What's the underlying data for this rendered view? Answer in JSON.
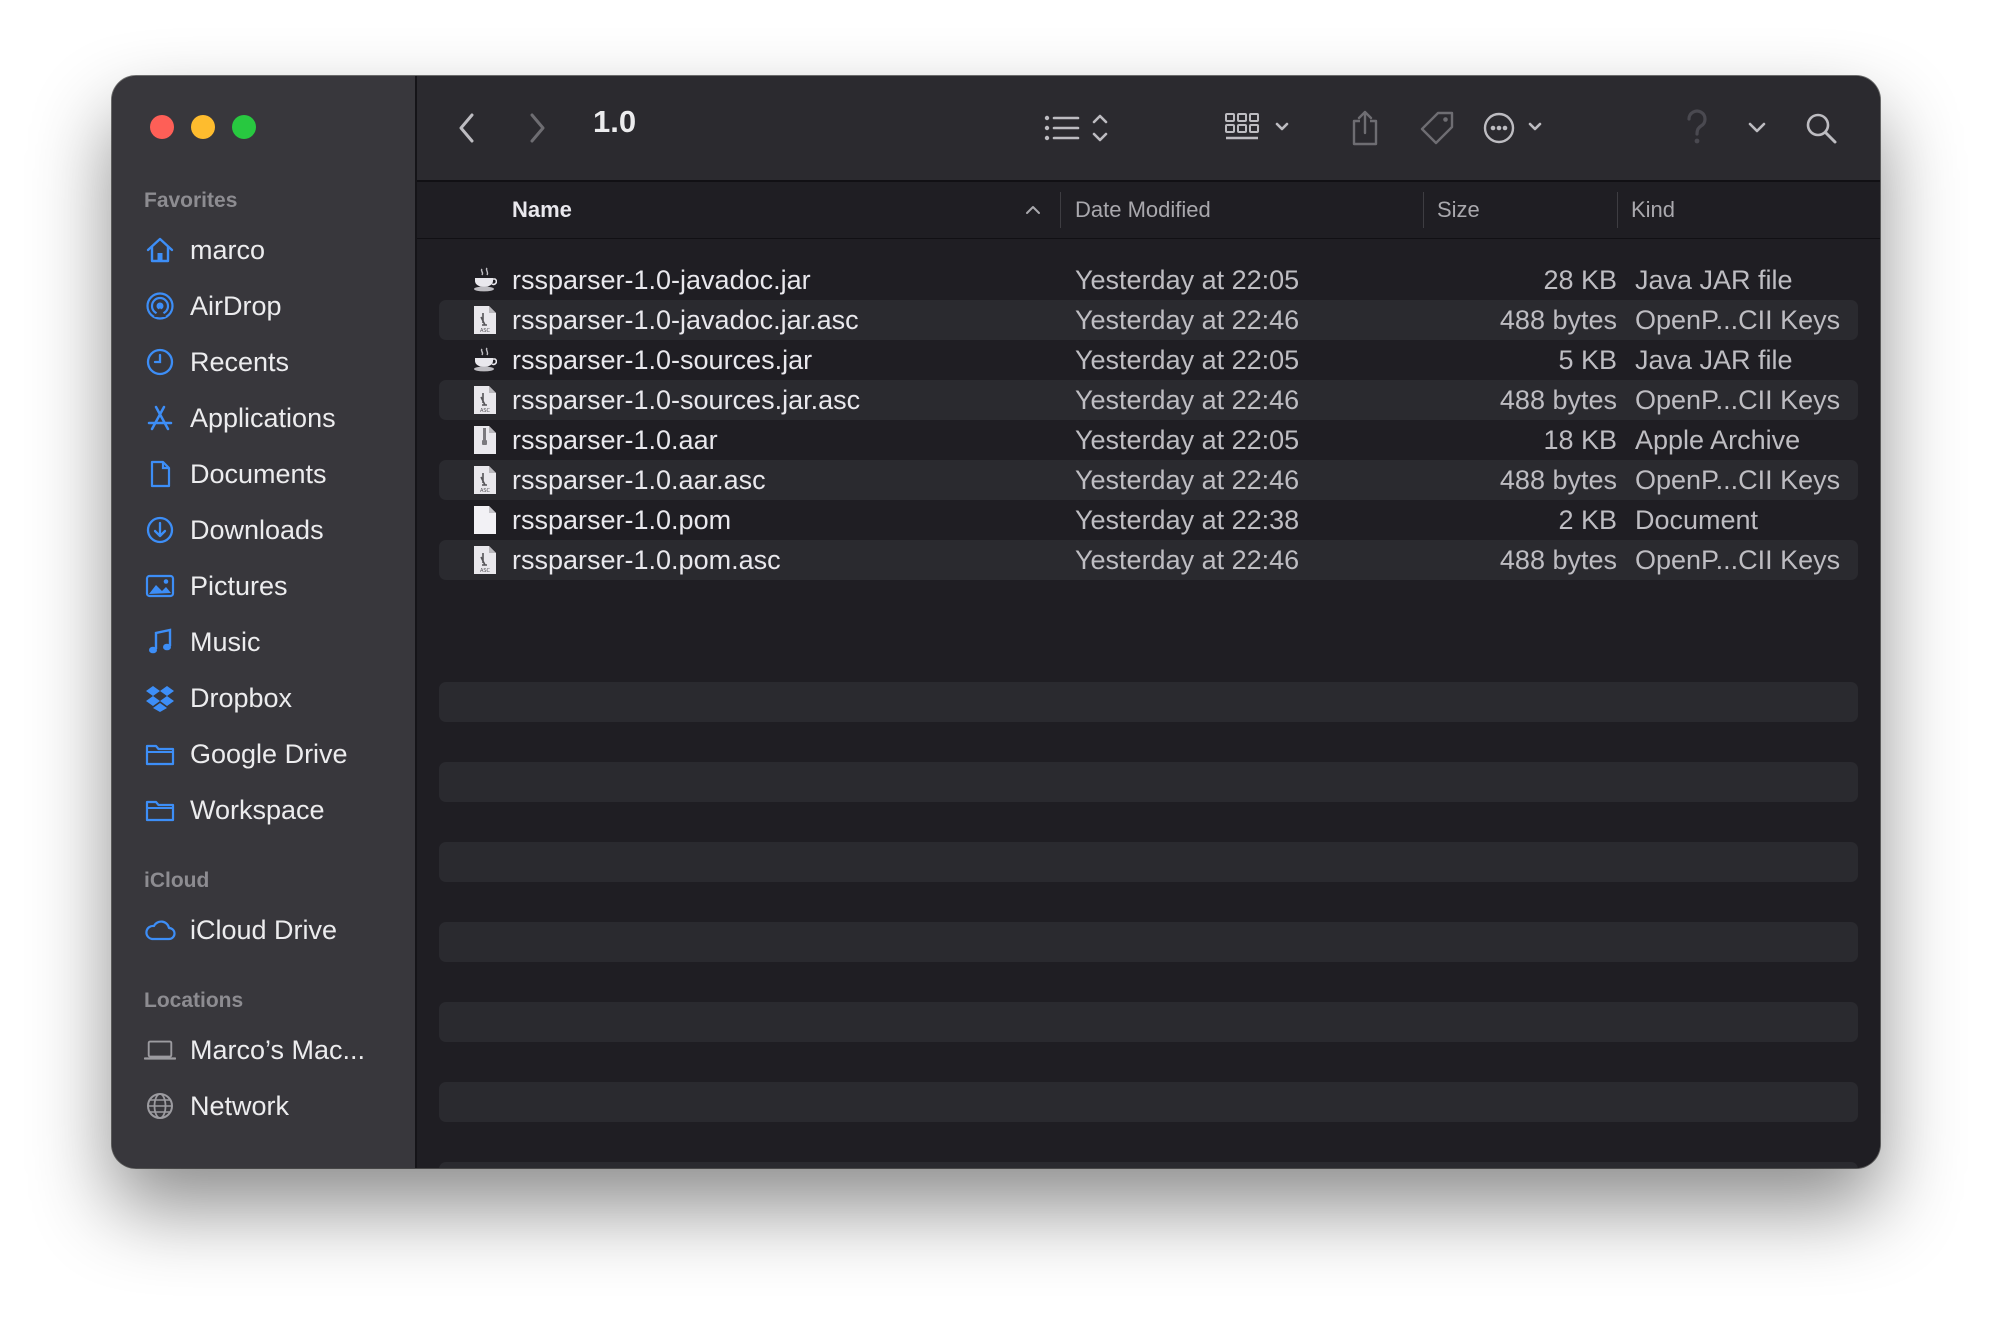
{
  "window": {
    "title": "1.0"
  },
  "sidebar": {
    "favorites_title": "Favorites",
    "favorites": [
      {
        "label": "marco",
        "icon": "home-icon"
      },
      {
        "label": "AirDrop",
        "icon": "airdrop-icon"
      },
      {
        "label": "Recents",
        "icon": "clock-icon"
      },
      {
        "label": "Applications",
        "icon": "applications-icon"
      },
      {
        "label": "Documents",
        "icon": "document-icon"
      },
      {
        "label": "Downloads",
        "icon": "download-icon"
      },
      {
        "label": "Pictures",
        "icon": "pictures-icon"
      },
      {
        "label": "Music",
        "icon": "music-icon"
      },
      {
        "label": "Dropbox",
        "icon": "dropbox-icon"
      },
      {
        "label": "Google Drive",
        "icon": "folder-icon"
      },
      {
        "label": "Workspace",
        "icon": "folder-icon"
      }
    ],
    "icloud_title": "iCloud",
    "icloud": [
      {
        "label": "iCloud Drive",
        "icon": "cloud-icon"
      }
    ],
    "locations_title": "Locations",
    "locations": [
      {
        "label": "Marco’s Mac...",
        "icon": "laptop-icon"
      },
      {
        "label": "Network",
        "icon": "globe-icon"
      }
    ]
  },
  "columns": {
    "name": "Name",
    "date": "Date Modified",
    "size": "Size",
    "kind": "Kind"
  },
  "files": [
    {
      "name": "rssparser-1.0-javadoc.jar",
      "date": "Yesterday at 22:05",
      "size": "28 KB",
      "kind": "Java JAR file",
      "icon": "jar-icon"
    },
    {
      "name": "rssparser-1.0-javadoc.jar.asc",
      "date": "Yesterday at 22:46",
      "size": "488 bytes",
      "kind": "OpenP...CII Keys",
      "icon": "asc-file-icon"
    },
    {
      "name": "rssparser-1.0-sources.jar",
      "date": "Yesterday at 22:05",
      "size": "5 KB",
      "kind": "Java JAR file",
      "icon": "jar-icon"
    },
    {
      "name": "rssparser-1.0-sources.jar.asc",
      "date": "Yesterday at 22:46",
      "size": "488 bytes",
      "kind": "OpenP...CII Keys",
      "icon": "asc-file-icon"
    },
    {
      "name": "rssparser-1.0.aar",
      "date": "Yesterday at 22:05",
      "size": "18 KB",
      "kind": "Apple Archive",
      "icon": "archive-icon"
    },
    {
      "name": "rssparser-1.0.aar.asc",
      "date": "Yesterday at 22:46",
      "size": "488 bytes",
      "kind": "OpenP...CII Keys",
      "icon": "asc-file-icon"
    },
    {
      "name": "rssparser-1.0.pom",
      "date": "Yesterday at 22:38",
      "size": "2 KB",
      "kind": "Document",
      "icon": "blank-document-icon"
    },
    {
      "name": "rssparser-1.0.pom.asc",
      "date": "Yesterday at 22:46",
      "size": "488 bytes",
      "kind": "OpenP...CII Keys",
      "icon": "asc-file-icon"
    }
  ],
  "colors": {
    "accent": "#3d8ef7",
    "window_bg": "#1f1e23",
    "sidebar_bg": "#38373c",
    "toolbar_bg": "#2b2a2f"
  }
}
